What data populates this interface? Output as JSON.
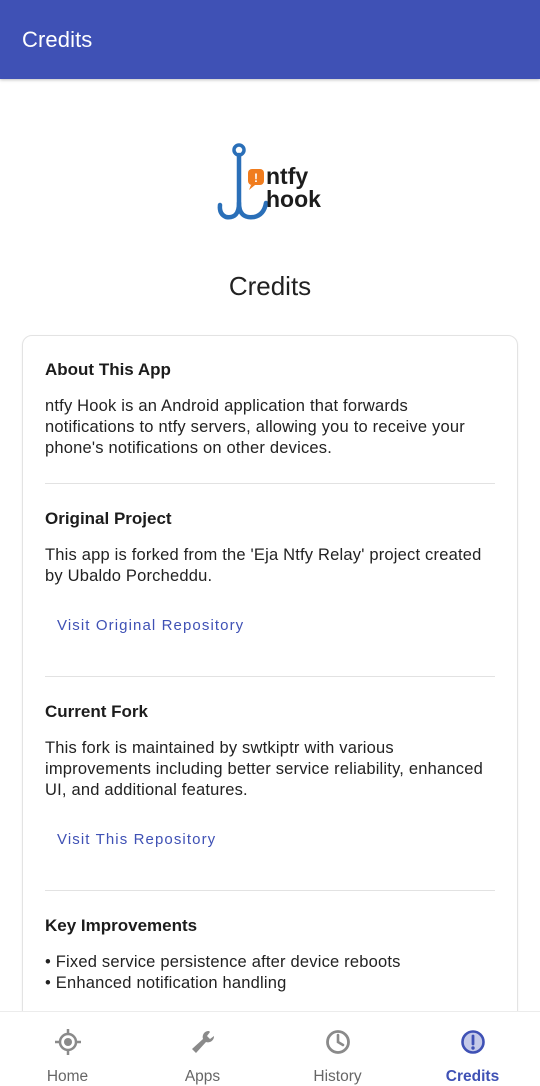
{
  "appbar": {
    "title": "Credits"
  },
  "logo": {
    "text_line1": "ntfy",
    "text_line2": "hook",
    "badge": "!"
  },
  "heading": "Credits",
  "sections": {
    "about": {
      "title": "About This App",
      "body": "ntfy Hook is an Android application that forwards notifications to ntfy servers, allowing you to receive your phone's notifications on other devices."
    },
    "original": {
      "title": "Original Project",
      "body": "This app is forked from the 'Eja Ntfy Relay' project created by Ubaldo Porcheddu.",
      "link": "Visit Original Repository"
    },
    "fork": {
      "title": "Current Fork",
      "body": "This fork is maintained by swtkiptr with various improvements including better service reliability, enhanced UI, and additional features.",
      "link": "Visit This Repository"
    },
    "improvements": {
      "title": "Key Improvements",
      "items": [
        "• Fixed service persistence after device reboots",
        "• Enhanced notification handling"
      ]
    }
  },
  "nav": {
    "items": [
      {
        "label": "Home",
        "icon": "crosshair-icon"
      },
      {
        "label": "Apps",
        "icon": "wrench-icon"
      },
      {
        "label": "History",
        "icon": "clock-icon"
      },
      {
        "label": "Credits",
        "icon": "info-icon"
      }
    ],
    "active": "Credits"
  },
  "colors": {
    "primary": "#3f51b5",
    "logo_blue": "#2a6fb8",
    "logo_orange": "#f07c1e",
    "nav_inactive": "#8a8a8a"
  }
}
